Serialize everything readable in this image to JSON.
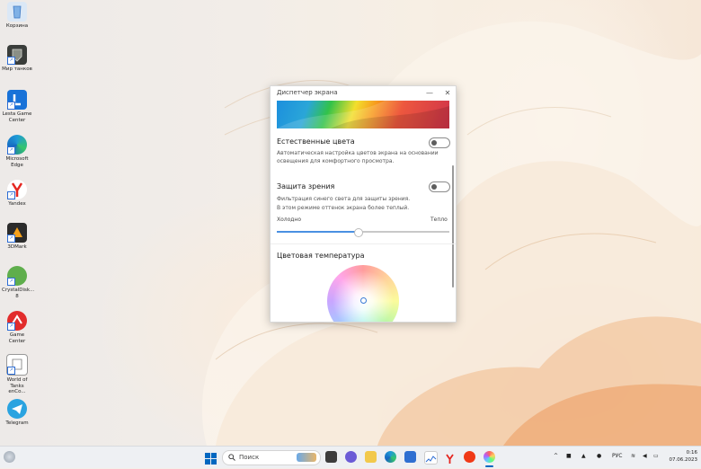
{
  "desktop": {
    "icons": [
      {
        "label": "Корзина",
        "icon": "recycle-bin-icon",
        "color": "#dbe8f6"
      },
      {
        "label": "Мир танков",
        "icon": "tank-game-icon",
        "color": "#3a3d3a"
      },
      {
        "label": "Lesta Game Center",
        "icon": "lesta-icon",
        "color": "#1872d8"
      },
      {
        "label": "Microsoft Edge",
        "icon": "edge-icon",
        "color": "#1f9ad6"
      },
      {
        "label": "Yandex",
        "icon": "yandex-browser-icon",
        "color": "#ffffff"
      },
      {
        "label": "3DMark",
        "icon": "3dmark-icon",
        "color": "#2b2b2b"
      },
      {
        "label": "CrystalDisk... 8",
        "icon": "crystaldisk-icon",
        "color": "#5fae4c"
      },
      {
        "label": "Game Center",
        "icon": "game-center-icon",
        "color": "#e22c2c"
      },
      {
        "label": "World of Tanks enCo...",
        "icon": "wot-shortcut-icon",
        "color": "#ffffff"
      },
      {
        "label": "Telegram",
        "icon": "telegram-icon",
        "color": "#2aa3e0"
      }
    ]
  },
  "window": {
    "title": "Диспетчер экрана",
    "minimize_glyph": "—",
    "close_glyph": "✕",
    "natural_colors": {
      "label": "Естественные цвета",
      "description": "Автоматическая настройка цветов экрана на основании освещения для комфортного просмотра."
    },
    "eye_protection": {
      "label": "Защита зрения",
      "description_1": "Фильтрация синего света для защиты зрения.",
      "description_2": "В этом режиме оттенок экрана более теплый.",
      "cold_label": "Холодно",
      "warm_label": "Тепло",
      "level": 0.47
    },
    "color_temperature": {
      "label": "Цветовая температура"
    }
  },
  "taskbar": {
    "search_placeholder": "Поиск",
    "language": "РУС",
    "time": "0:16",
    "date": "07.06.2023",
    "colors": {
      "accent": "#0067c0",
      "bg": "#eef0f3"
    }
  }
}
